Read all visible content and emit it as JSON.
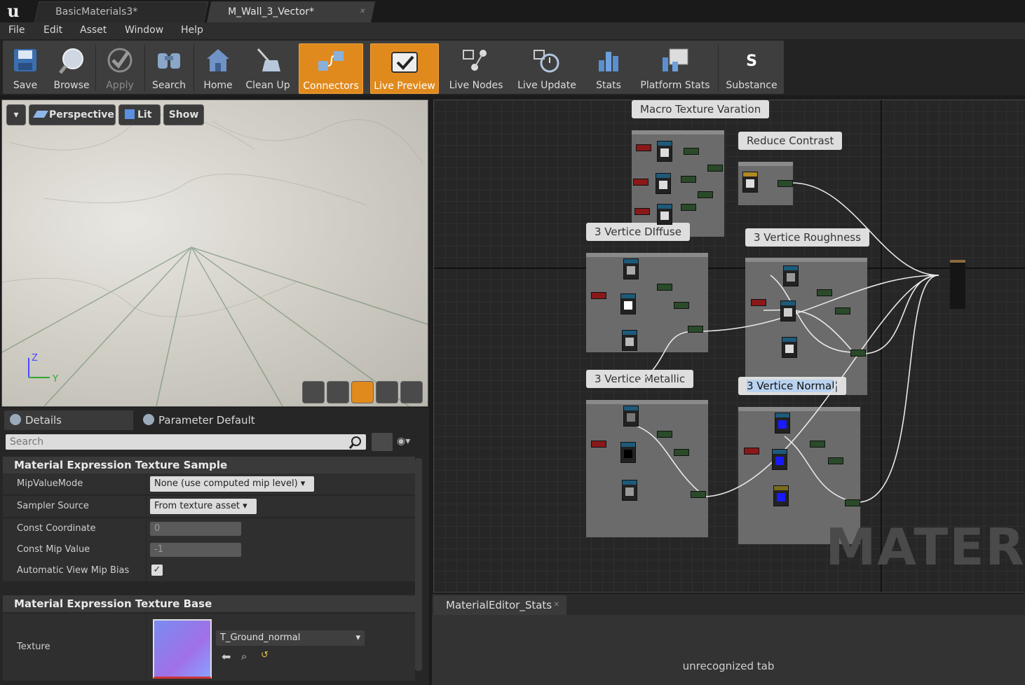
{
  "titlebar": {
    "tabs": [
      {
        "label": "BasicMaterials3*"
      },
      {
        "label": "M_Wall_3_Vector*"
      }
    ]
  },
  "menu": [
    "File",
    "Edit",
    "Asset",
    "Window",
    "Help"
  ],
  "toolbar": [
    {
      "label": "Save",
      "icon": "save-icon"
    },
    {
      "label": "Browse",
      "icon": "browse-icon"
    },
    {
      "label": "Apply",
      "icon": "apply-icon",
      "state": "disabled"
    },
    {
      "label": "Search",
      "icon": "search-icon"
    },
    {
      "label": "Home",
      "icon": "home-icon"
    },
    {
      "label": "Clean Up",
      "icon": "clean-up-icon"
    },
    {
      "label": "Connectors",
      "icon": "connectors-icon",
      "state": "active"
    },
    {
      "label": "Live Preview",
      "icon": "live-preview-icon",
      "state": "active"
    },
    {
      "label": "Live Nodes",
      "icon": "live-nodes-icon"
    },
    {
      "label": "Live Update",
      "icon": "live-update-icon"
    },
    {
      "label": "Stats",
      "icon": "stats-icon"
    },
    {
      "label": "Platform Stats",
      "icon": "platform-stats-icon"
    },
    {
      "label": "Substance",
      "icon": "substance-icon"
    }
  ],
  "viewport": {
    "perspective": "Perspective",
    "lit": "Lit",
    "show": "Show",
    "axes": {
      "z": "Z",
      "y": "Y"
    }
  },
  "details": {
    "tabs": [
      {
        "label": "Details"
      },
      {
        "label": "Parameter Default"
      }
    ],
    "search_placeholder": "Search",
    "sections": [
      {
        "title": "Material Expression Texture Sample",
        "rows": [
          {
            "name": "MipValueMode",
            "value": "None (use computed mip level)"
          },
          {
            "name": "Sampler Source",
            "value": "From texture asset"
          },
          {
            "name": "Const Coordinate",
            "value": "0"
          },
          {
            "name": "Const Mip Value",
            "value": "-1"
          },
          {
            "name": "Automatic View Mip Bias",
            "value": "✓"
          }
        ]
      },
      {
        "title": "Material Expression Texture Base",
        "rows": [
          {
            "name": "Texture",
            "value": "T_Ground_normal"
          }
        ]
      }
    ]
  },
  "graph": {
    "comments": [
      "Macro Texture Varation",
      "Reduce Contrast",
      "3 Vertice DIffuse",
      "3 Vertice Roughness",
      "3 Vertice Metallic",
      "3 Vertice Normal"
    ],
    "watermark": "MATER"
  },
  "stats": {
    "tab": "MaterialEditor_Stats",
    "message": "unrecognized tab"
  }
}
